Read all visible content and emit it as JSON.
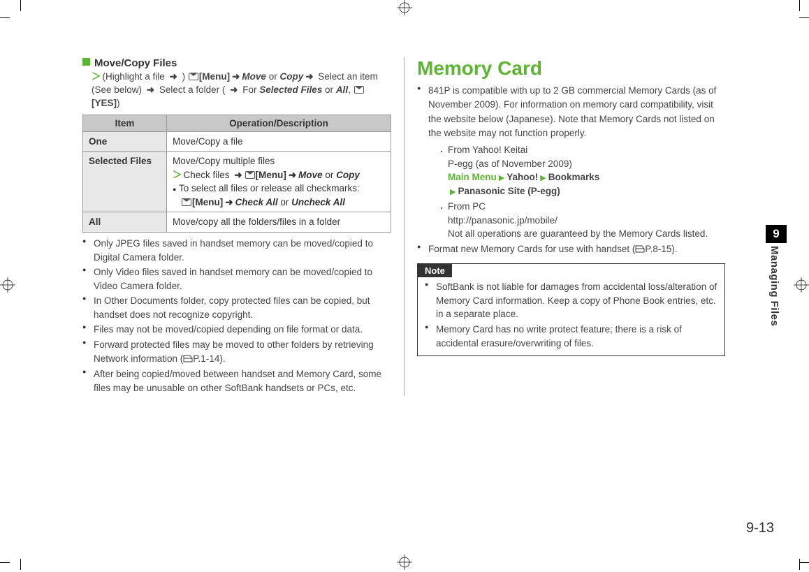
{
  "left": {
    "heading": "Move/Copy Files",
    "intro_1": "(Highlight a file ",
    "intro_arrow1": "➜",
    "intro_2": " ) ",
    "intro_menu": "[Menu]",
    "intro_arrow2": "➜",
    "intro_move": "Move",
    "intro_or1": " or ",
    "intro_copy": "Copy",
    "intro_arrow3": "➜",
    "intro_3": " Select an item (See below) ",
    "intro_arrow4": "➜",
    "intro_4": " Select a folder ( ",
    "intro_arrow5": "➜",
    "intro_5": " For ",
    "intro_sel": "Selected Files",
    "intro_or2": " or ",
    "intro_all": "All",
    "intro_comma": ", ",
    "intro_yes": "[YES]",
    "intro_close": ")",
    "th_item": "Item",
    "th_op": "Operation/Description",
    "row_one_label": "One",
    "row_one_desc": "Move/Copy a file",
    "row_sel_label": "Selected Files",
    "row_sel_l1": "Move/Copy multiple files",
    "row_sel_check": "Check files ",
    "row_sel_arrow1": "➜",
    "row_sel_menu": "[Menu]",
    "row_sel_arrow2": "➜",
    "row_sel_move": "Move",
    "row_sel_or": " or ",
    "row_sel_copy": "Copy",
    "row_sel_bul": "To select all files or release all checkmarks:",
    "row_sel_menu2": "[Menu]",
    "row_sel_arrow3": "➜",
    "row_sel_chkall": "Check All",
    "row_sel_or2": " or ",
    "row_sel_unchk": "Uncheck All",
    "row_all_label": "All",
    "row_all_desc": "Move/copy all the folders/files in a folder",
    "b1": "Only JPEG files saved in handset memory can be moved/copied to Digital Camera folder.",
    "b2": "Only Video files saved in handset memory can be moved/copied to Video Camera folder.",
    "b3": "In Other Documents folder, copy protected files can be copied, but handset does not recognize copyright.",
    "b4": "Files may not be moved/copied depending on file format or data.",
    "b5a": "Forward protected files may be moved to other folders by retrieving Network information (",
    "b5ref": "P.1-14",
    "b5b": ").",
    "b6": "After being copied/moved between handset and Memory Card, some files may be unusable on other SoftBank handsets or PCs, etc."
  },
  "right": {
    "title": "Memory Card",
    "p1": "841P is compatible with up to 2 GB commercial Memory Cards (as of November 2009). For information on memory card compatibility, visit the website below (Japanese). Note that Memory Cards not listed on the website may not function properly.",
    "d1a": "From Yahoo! Keitai",
    "d1b": "P-egg (as of November 2009)",
    "mm": "Main Menu",
    "yahoo": "Yahoo!",
    "bookmarks": "Bookmarks",
    "psite": "Panasonic Site (P-egg)",
    "d2a": "From PC",
    "d2b": "http://panasonic.jp/mobile/",
    "d2c": "Not all operations are guaranteed by the Memory Cards listed.",
    "p2a": "Format new Memory Cards for use with handset (",
    "p2ref": "P.8-15",
    "p2b": ").",
    "note_label": "Note",
    "n1": "SoftBank is not liable for damages from accidental loss/alteration of Memory Card information. Keep a copy of Phone Book entries, etc. in a separate place.",
    "n2": "Memory Card has no write protect feature; there is a risk of accidental erasure/overwriting of files."
  },
  "side": {
    "chapter": "9",
    "label": "Managing Files"
  },
  "pagenum": "9-13"
}
